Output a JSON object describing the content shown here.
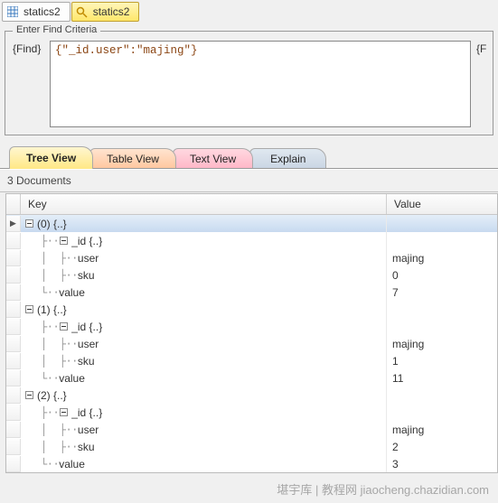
{
  "topTabs": [
    {
      "label": "statics2",
      "active": false
    },
    {
      "label": "statics2",
      "active": true
    }
  ],
  "criteria": {
    "legend": "Enter Find Criteria",
    "findLabel": "{Find}",
    "findValue": "{\"_id.user\":\"majing\"}",
    "extra": "{F"
  },
  "viewTabs": {
    "tree": "Tree View",
    "table": "Table View",
    "text": "Text View",
    "explain": "Explain"
  },
  "status": "3 Documents",
  "columns": {
    "key": "Key",
    "value": "Value"
  },
  "rows": [
    {
      "level": 0,
      "pointer": true,
      "expand": "minus",
      "label": "(0) {..}",
      "value": "",
      "sel": true
    },
    {
      "level": 1,
      "expand": "minus",
      "label": "_id {..}",
      "value": ""
    },
    {
      "level": 2,
      "leaf": true,
      "label": "user",
      "value": "majing"
    },
    {
      "level": 2,
      "leaf": true,
      "label": "sku",
      "value": "0"
    },
    {
      "level": 1,
      "leaf": true,
      "last": true,
      "label": "value",
      "value": "7"
    },
    {
      "level": 0,
      "expand": "minus",
      "label": "(1) {..}",
      "value": ""
    },
    {
      "level": 1,
      "expand": "minus",
      "label": "_id {..}",
      "value": ""
    },
    {
      "level": 2,
      "leaf": true,
      "label": "user",
      "value": "majing"
    },
    {
      "level": 2,
      "leaf": true,
      "label": "sku",
      "value": "1"
    },
    {
      "level": 1,
      "leaf": true,
      "last": true,
      "label": "value",
      "value": "11"
    },
    {
      "level": 0,
      "expand": "minus",
      "label": "(2) {..}",
      "value": ""
    },
    {
      "level": 1,
      "expand": "minus",
      "label": "_id {..}",
      "value": ""
    },
    {
      "level": 2,
      "leaf": true,
      "label": "user",
      "value": "majing"
    },
    {
      "level": 2,
      "leaf": true,
      "label": "sku",
      "value": "2"
    },
    {
      "level": 1,
      "leaf": true,
      "last": true,
      "label": "value",
      "value": "3"
    }
  ],
  "watermark": "堪宇库 | 教程网\njiaocheng.chazidian.com"
}
